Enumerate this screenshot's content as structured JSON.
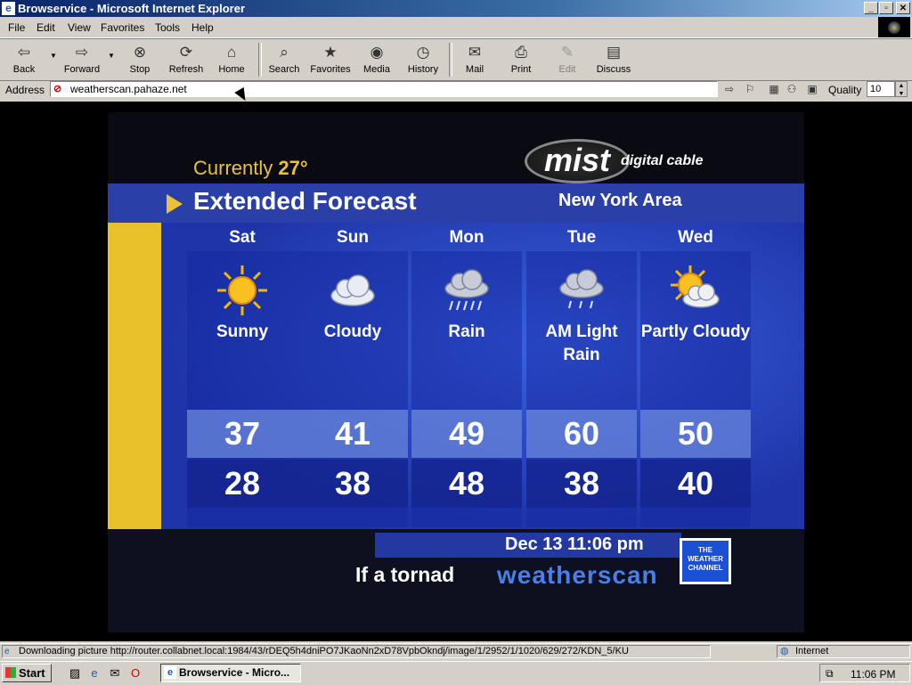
{
  "window": {
    "title": "Browservice - Microsoft Internet Explorer",
    "app_icon": "ie-icon"
  },
  "menu": {
    "items": [
      "File",
      "Edit",
      "View",
      "Favorites",
      "Tools",
      "Help"
    ]
  },
  "toolbar": {
    "back": "Back",
    "forward": "Forward",
    "stop": "Stop",
    "refresh": "Refresh",
    "home": "Home",
    "search": "Search",
    "favorites": "Favorites",
    "media": "Media",
    "history": "History",
    "mail": "Mail",
    "print": "Print",
    "edit": "Edit",
    "discuss": "Discuss"
  },
  "address": {
    "label": "Address",
    "value": "weatherscan.pahaze.net",
    "quality_label": "Quality",
    "quality_value": "10"
  },
  "weather": {
    "currently_label": "Currently",
    "currently_temp": "27°",
    "brand": "mist",
    "brand_sub": "digital cable",
    "header_title": "Extended Forecast",
    "area": "New York Area",
    "days": [
      {
        "day": "Sat",
        "condition": "Sunny",
        "icon": "sun-icon",
        "high": "37",
        "low": "28"
      },
      {
        "day": "Sun",
        "condition": "Cloudy",
        "icon": "cloud-icon",
        "high": "41",
        "low": "38"
      },
      {
        "day": "Mon",
        "condition": "Rain",
        "icon": "rain-icon",
        "high": "49",
        "low": "48"
      },
      {
        "day": "Tue",
        "condition": "AM Light Rain",
        "icon": "light-rain-icon",
        "high": "60",
        "low": "38"
      },
      {
        "day": "Wed",
        "condition": "Partly Cloudy",
        "icon": "partly-cloudy-icon",
        "high": "50",
        "low": "40"
      }
    ],
    "datetime": "Dec 13 11:06 pm",
    "ticker": "If a tornad",
    "ws_brand": "weatherscan",
    "twc_logo": "THE WEATHER CHANNEL"
  },
  "status": {
    "text": "Downloading picture http://router.collabnet.local:1984/43/rDEQ5h4dniPO7JKaoNn2xD78VpbOkndj/image/1/2952/1/1020/629/272/KDN_5/KU",
    "zone": "Internet"
  },
  "taskbar": {
    "start": "Start",
    "task_item": "Browservice - Micro...",
    "clock": "11:06 PM"
  },
  "colors": {
    "title_blue": "#0a246a",
    "forecast_blue": "#2a44b8",
    "accent_yellow": "#e9c23a"
  }
}
